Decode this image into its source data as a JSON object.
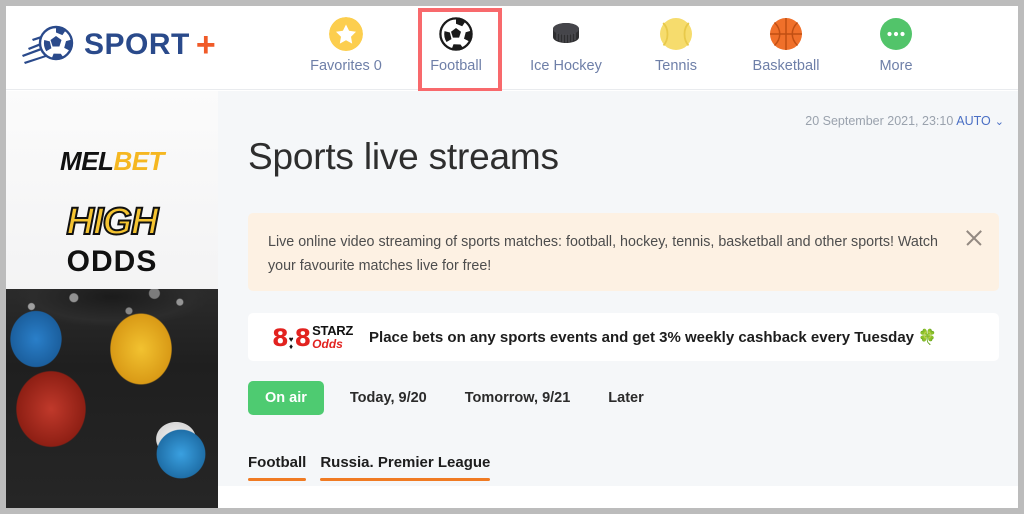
{
  "brand": {
    "name": "SPORT",
    "plus": "+",
    "logo_icon": "soccer-ball-motion-logo",
    "text_color": "#2a4a8b",
    "plus_color": "#f05a28"
  },
  "nav": {
    "items": [
      {
        "label": "Favorites 0",
        "icon": "star-icon",
        "color": "#fcce4e",
        "active": false
      },
      {
        "label": "Football",
        "icon": "football-icon",
        "color": "#ffffff",
        "active": true
      },
      {
        "label": "Ice Hockey",
        "icon": "hockey-puck-icon",
        "color": "#3a3a3c",
        "active": false
      },
      {
        "label": "Tennis",
        "icon": "tennis-ball-icon",
        "color": "#f6dc6d",
        "active": false
      },
      {
        "label": "Basketball",
        "icon": "basketball-icon",
        "color": "#f0702a",
        "active": false
      },
      {
        "label": "More",
        "icon": "ellipsis-icon",
        "color": "#52c46a",
        "active": false
      }
    ],
    "highlight_color": "#f8696c"
  },
  "sidebar_ad": {
    "brand_part1": "MEL",
    "brand_part2": "BET",
    "headline": "HIGH",
    "subhead": "ODDS",
    "image_alt": "athletes-collage-photo",
    "brand_part1_color": "#111111",
    "brand_part2_color": "#f5b721",
    "headline_color": "#f5c431"
  },
  "content": {
    "timestamp": "20 September 2021, 23:10",
    "timestamp_mode": "AUTO",
    "timestamp_chevron": "⌄",
    "page_title": "Sports live streams",
    "notice": {
      "text": "Live online video streaming of sports matches: football, hockey, tennis, basketball and other sports! Watch your favourite matches live for free!",
      "close_icon": "close-icon",
      "background": "#fdf1e3"
    },
    "promo": {
      "logo_8_left": "8",
      "logo_suit_top": "♥",
      "logo_suit_bottom": "♦",
      "logo_8_right": "8",
      "logo_starz": "STARZ",
      "logo_odds": "Odds",
      "text": "Place bets on any sports events and get 3% weekly cashback every Tuesday",
      "emoji": "🍀"
    },
    "filters": [
      {
        "label": "On air",
        "active": true
      },
      {
        "label": "Today, 9/20",
        "active": false
      },
      {
        "label": "Tomorrow, 9/21",
        "active": false
      },
      {
        "label": "Later",
        "active": false
      }
    ],
    "filter_active_color": "#4ecb71",
    "subtabs": [
      {
        "label": "Football",
        "width": 68
      },
      {
        "label": "Russia. Premier League",
        "width": 174
      }
    ],
    "subtab_underline_color": "#f07b23"
  }
}
